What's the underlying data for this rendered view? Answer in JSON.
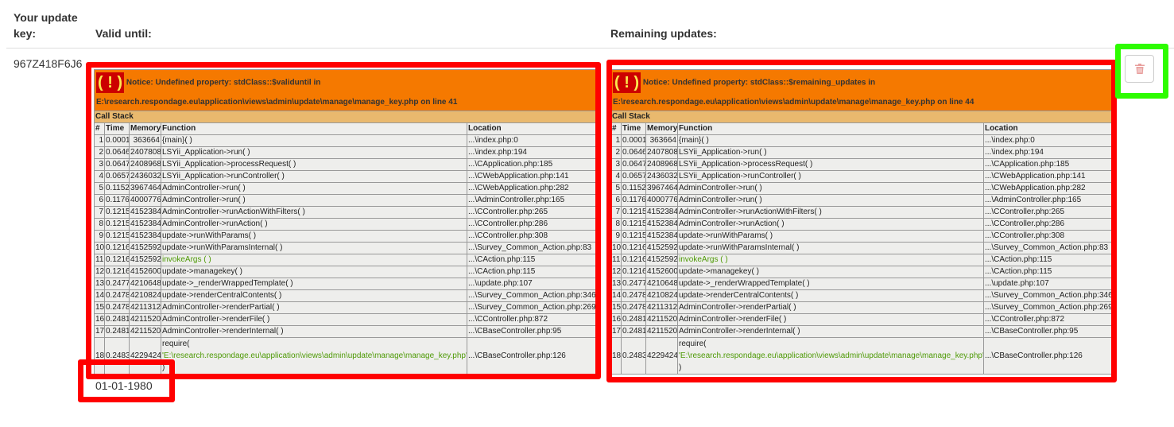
{
  "headers": {
    "key": "Your update key:",
    "valid_until": "Valid until:",
    "remaining": "Remaining updates:"
  },
  "row": {
    "key": "967Z418F6J6",
    "valid_until": "01-01-1980"
  },
  "colors": {
    "accent_red": "#d9534f",
    "notice_orange": "#f57900",
    "callstack_tan": "#e9b96e"
  },
  "notices": [
    {
      "message": "Notice: Undefined property: stdClass::$validuntil in",
      "file": "E:\\research.respondage.eu\\application\\views\\admin\\update\\manage\\manage_key.php on line 41"
    },
    {
      "message": "Notice: Undefined property: stdClass::$remaining_updates in",
      "file": "E:\\research.respondage.eu\\application\\views\\admin\\update\\manage\\manage_key.php on line 44"
    }
  ],
  "bang": "( ! )",
  "call_stack_label": "Call Stack",
  "columns": [
    "#",
    "Time",
    "Memory",
    "Function",
    "Location"
  ],
  "call_stack": [
    [
      "1",
      "0.0001",
      "363664",
      "{main}( )",
      "...\\index.php:0"
    ],
    [
      "2",
      "0.0646",
      "2407808",
      "LSYii_Application->run( )",
      "...\\index.php:194"
    ],
    [
      "3",
      "0.0647",
      "2408968",
      "LSYii_Application->processRequest( )",
      "...\\CApplication.php:185"
    ],
    [
      "4",
      "0.0657",
      "2436032",
      "LSYii_Application->runController( )",
      "...\\CWebApplication.php:141"
    ],
    [
      "5",
      "0.1152",
      "3967464",
      "AdminController->run( )",
      "...\\CWebApplication.php:282"
    ],
    [
      "6",
      "0.1176",
      "4000776",
      "AdminController->run( )",
      "...\\AdminController.php:165"
    ],
    [
      "7",
      "0.1215",
      "4152384",
      "AdminController->runActionWithFilters( )",
      "...\\CController.php:265"
    ],
    [
      "8",
      "0.1215",
      "4152384",
      "AdminController->runAction( )",
      "...\\CController.php:286"
    ],
    [
      "9",
      "0.1215",
      "4152384",
      "update->runWithParams( )",
      "...\\CController.php:308"
    ],
    [
      "10",
      "0.1216",
      "4152592",
      "update->runWithParamsInternal( )",
      "...\\Survey_Common_Action.php:83"
    ],
    [
      "11",
      "0.1216",
      "4152592",
      "invokeArgs ( )",
      "...\\CAction.php:115"
    ],
    [
      "12",
      "0.1216",
      "4152600",
      "update->managekey( )",
      "...\\CAction.php:115"
    ],
    [
      "13",
      "0.2477",
      "4210648",
      "update->_renderWrappedTemplate( )",
      "...\\update.php:107"
    ],
    [
      "14",
      "0.2478",
      "4210824",
      "update->renderCentralContents( )",
      "...\\Survey_Common_Action.php:346"
    ],
    [
      "15",
      "0.2478",
      "4211312",
      "AdminController->renderPartial( )",
      "...\\Survey_Common_Action.php:269"
    ],
    [
      "16",
      "0.2481",
      "4211520",
      "AdminController->renderFile( )",
      "...\\CController.php:872"
    ],
    [
      "17",
      "0.2481",
      "4211520",
      "AdminController->renderInternal( )",
      "...\\CBaseController.php:95"
    ]
  ],
  "last_row": {
    "n": "18",
    "time": "0.2483",
    "memory": "4229424",
    "func_open": "require(",
    "func_arg": "'E:\\research.respondage.eu\\application\\views\\admin\\update\\manage\\manage_key.php'",
    "func_close": ")",
    "location": "...\\CBaseController.php:126"
  },
  "delete_button": {
    "icon": "trash-icon"
  }
}
